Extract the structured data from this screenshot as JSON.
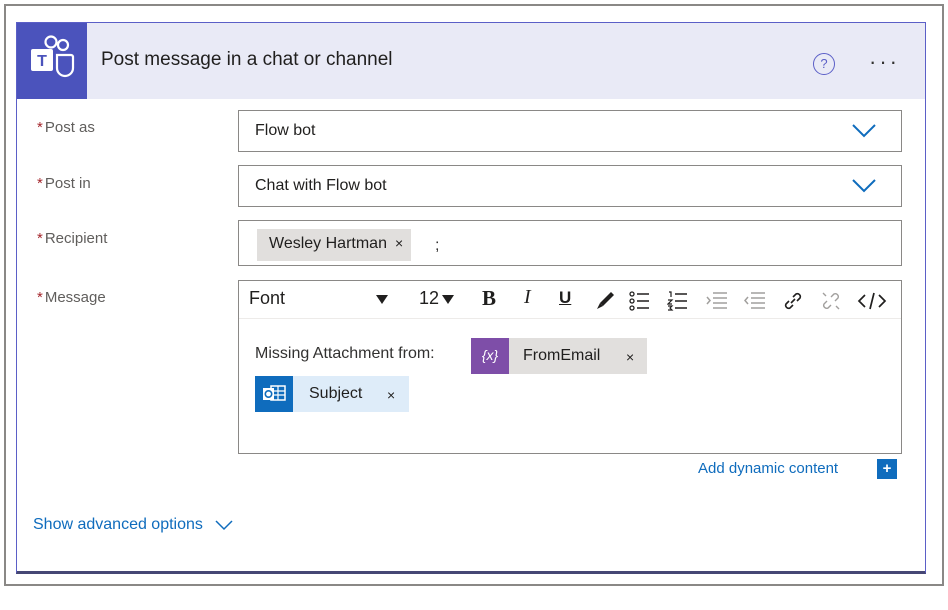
{
  "header": {
    "title": "Post message in a chat or channel",
    "help_glyph": "?",
    "more_glyph": "···"
  },
  "fields": {
    "post_as": {
      "label": "Post as",
      "value": "Flow bot"
    },
    "post_in": {
      "label": "Post in",
      "value": "Chat with Flow bot"
    },
    "recipient": {
      "label": "Recipient",
      "token": "Wesley Hartman",
      "separator": ";"
    },
    "message": {
      "label": "Message",
      "toolbar": {
        "font": "Font",
        "size": "12",
        "bold": "B",
        "italic": "I",
        "underline": "U"
      },
      "text": "Missing Attachment from:",
      "token_fromemail": "FromEmail",
      "token_subject": "Subject",
      "expression_glyph": "{x}"
    }
  },
  "required_marker": "*",
  "token_remove": "×",
  "add_dynamic_content": "Add dynamic content",
  "add_dynamic_plus": "+",
  "show_advanced_options": "Show advanced options",
  "colors": {
    "teams": "#4b53bc",
    "expression": "#7e4ea8",
    "outlook": "#0f6cbd",
    "link": "#0f6cbd",
    "required": "#a4262c"
  }
}
